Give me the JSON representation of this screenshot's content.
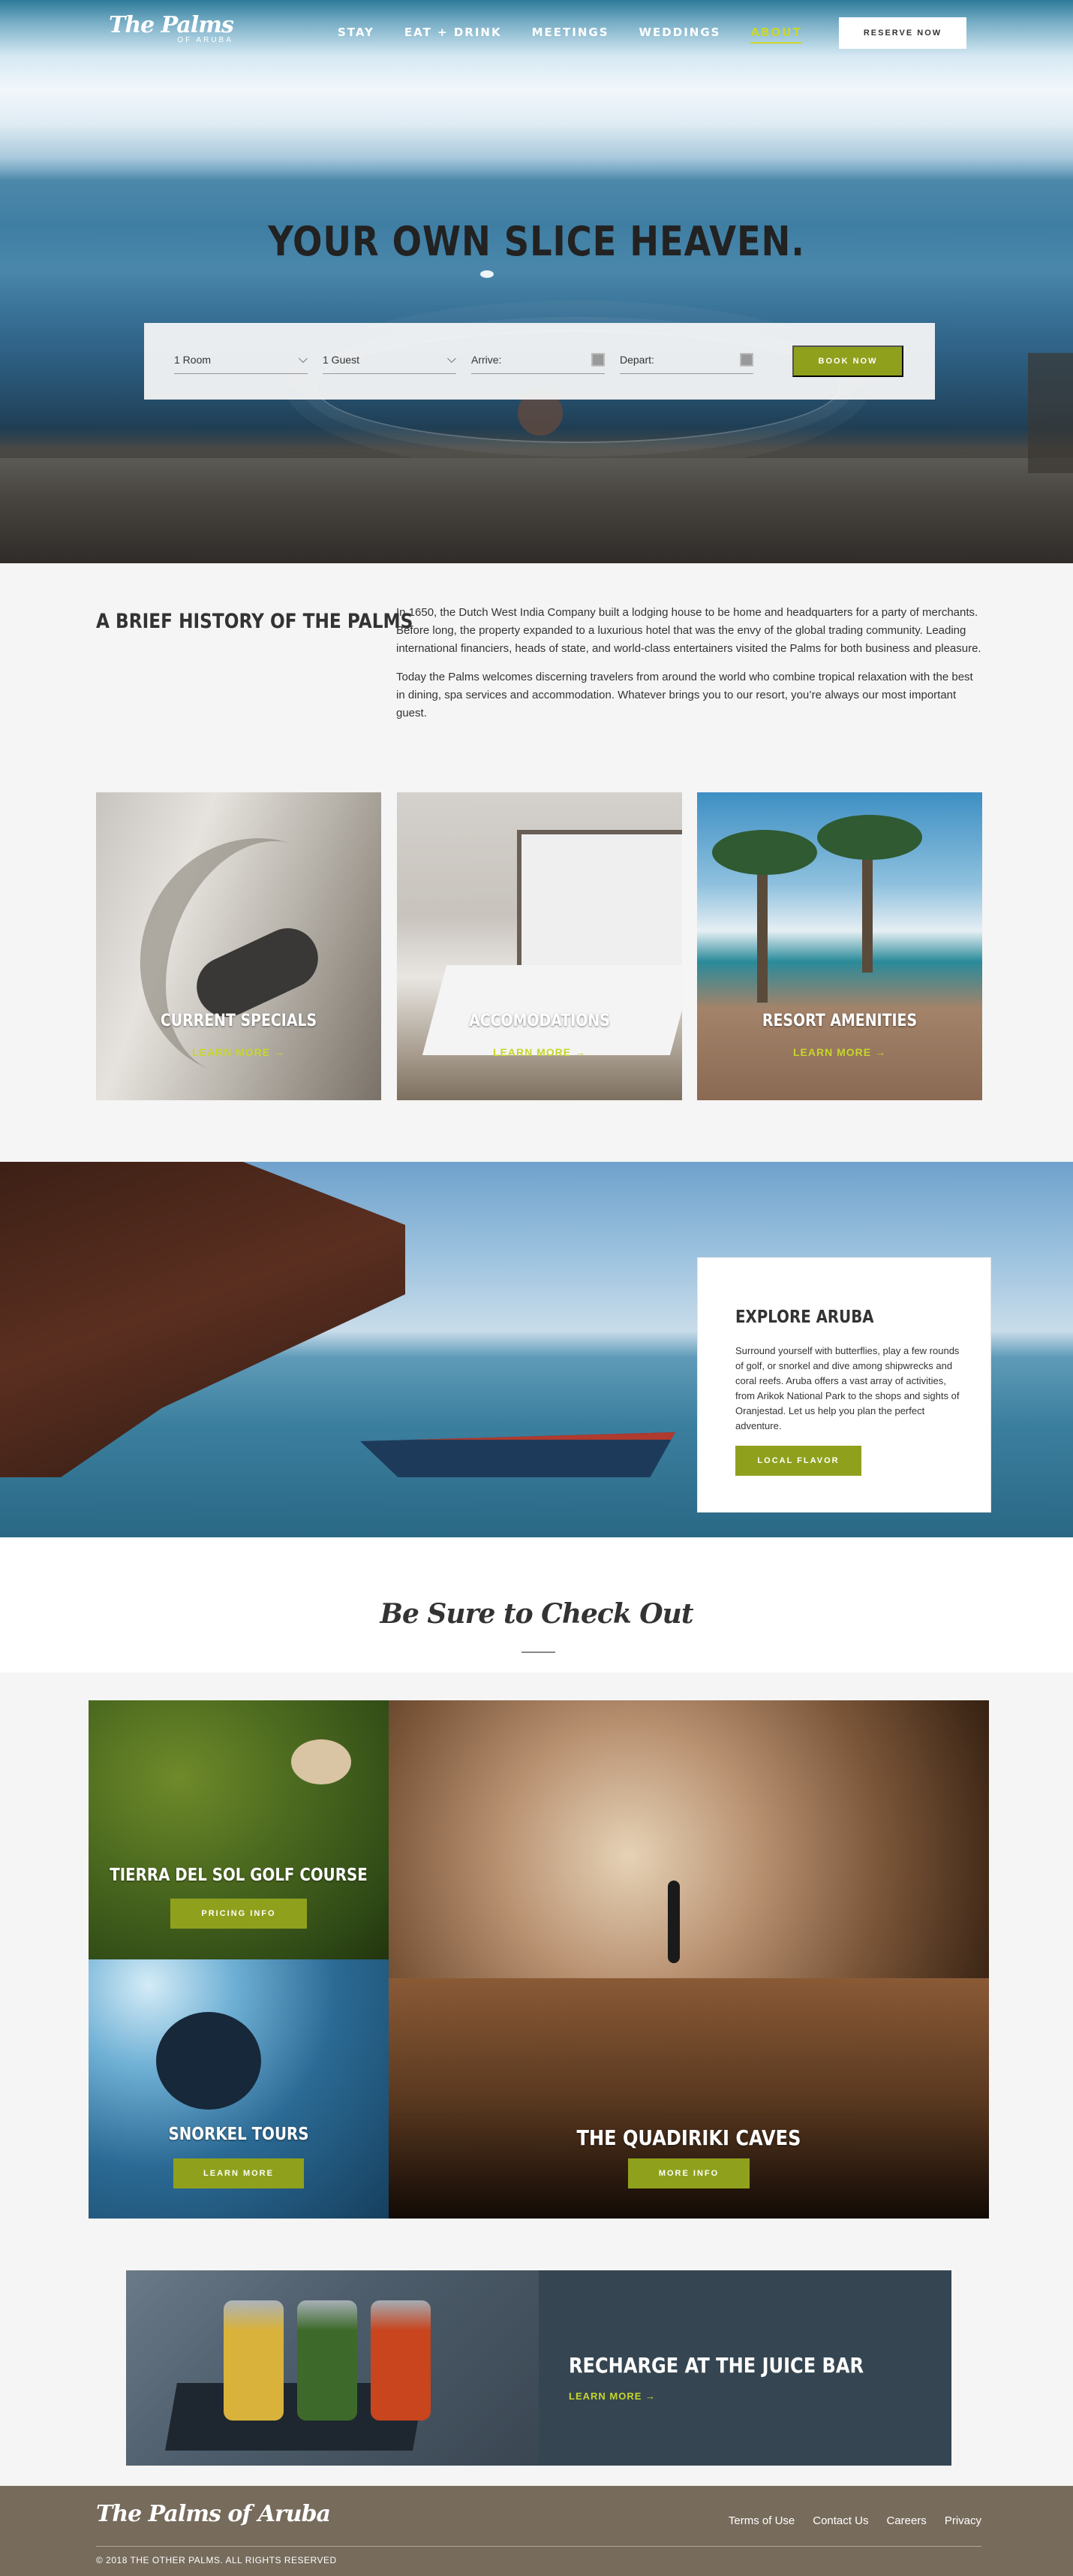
{
  "header": {
    "logo_script": "The Palms",
    "logo_sub": "OF ARUBA",
    "nav": [
      {
        "label": "STAY"
      },
      {
        "label": "EAT + DRINK"
      },
      {
        "label": "MEETINGS"
      },
      {
        "label": "WEDDINGS"
      },
      {
        "label": "ABOUT",
        "active": true
      }
    ],
    "reserve_label": "RESERVE NOW"
  },
  "hero": {
    "title": "YOUR OWN SLICE HEAVEN."
  },
  "booking": {
    "rooms_value": "1 Room",
    "guests_value": "1 Guest",
    "arrive_label": "Arrive:",
    "depart_label": "Depart:",
    "book_label": "BOOK NOW"
  },
  "history": {
    "title": "A BRIEF HISTORY OF THE PALMS",
    "paragraph1": "In 1650, the Dutch West India Company built a lodging house to be home and headquarters for a party of merchants. Before long, the property expanded to a luxurious hotel that was the envy of the global trading community. Leading international financiers, heads of state, and world-class entertainers visited the Palms for both business and pleasure.",
    "paragraph2": "Today the Palms welcomes discerning travelers from around the world who combine tropical relaxation with the best in dining, spa services and accommodation. Whatever brings you to our resort, you’re always our most important guest."
  },
  "cards": [
    {
      "title": "CURRENT SPECIALS",
      "link": "LEARN MORE →"
    },
    {
      "title": "ACCOMODATIONS",
      "link": "LEARN MORE →"
    },
    {
      "title": "RESORT AMENITIES",
      "link": "LEARN MORE →"
    }
  ],
  "explore": {
    "title": "EXPLORE ARUBA",
    "text": "Surround yourself with butterflies, play a few rounds of golf, or snorkel and dive among shipwrecks and coral reefs. Aruba offers a vast array of activities, from Arikok National Park to the shops and sights of Oranjestad. Let us help you plan the perfect adventure.",
    "button": "LOCAL FLAVOR"
  },
  "check_out": {
    "title": "Be Sure to Check Out",
    "tiles": [
      {
        "title": "TIERRA DEL SOL GOLF COURSE",
        "button": "PRICING INFO"
      },
      {
        "title": "SNORKEL TOURS",
        "button": "LEARN MORE"
      },
      {
        "title": "THE QUADIRIKI CAVES",
        "button": "MORE INFO"
      }
    ]
  },
  "juice": {
    "title": "RECHARGE AT THE JUICE BAR",
    "link": "LEARN MORE →",
    "glass_colors": [
      "#d8b23a",
      "#3d6a2a",
      "#c8451e"
    ]
  },
  "footer": {
    "logo": "The Palms of Aruba",
    "links": [
      "Terms of Use",
      "Contact Us",
      "Careers",
      "Privacy"
    ],
    "copyright": "© 2018 THE OTHER PALMS. ALL RIGHTS RESERVED"
  },
  "colors": {
    "accent_green": "#8fa11c",
    "link_green": "#c6d62c",
    "juice_panel": "#354652",
    "footer_bg": "#776b5c"
  }
}
